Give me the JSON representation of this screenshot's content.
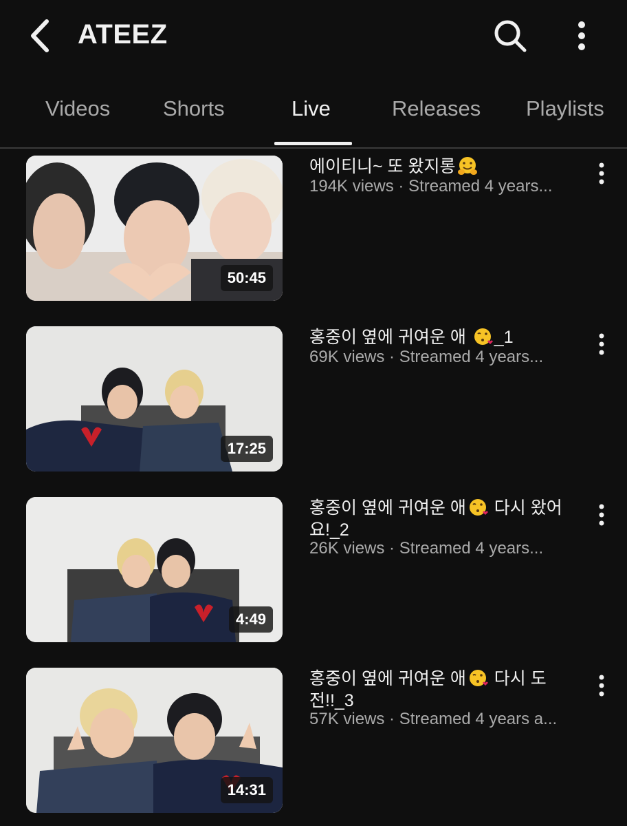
{
  "header": {
    "title": "ATEEZ",
    "back_icon": "chevron-left-icon",
    "search_icon": "search-icon",
    "more_icon": "more-vertical-icon"
  },
  "tabs": [
    {
      "label": "Videos"
    },
    {
      "label": "Shorts"
    },
    {
      "label": "Live",
      "active": true
    },
    {
      "label": "Releases"
    },
    {
      "label": "Playlists"
    }
  ],
  "videos": [
    {
      "title_pre": "에이티니~ 또 왔지롱",
      "title_emoji": "hugging-face-emoji",
      "title_post": "",
      "meta": "194K views · Streamed 4 years...",
      "duration": "50:45"
    },
    {
      "title_pre": "홍중이 옆에 귀여운 애 ",
      "title_emoji": "face-blowing-kiss-emoji",
      "title_post": "_1",
      "meta": "69K views · Streamed 4 years...",
      "duration": "17:25"
    },
    {
      "title_pre": "홍중이 옆에 귀여운 애",
      "title_emoji": "face-blowing-kiss-emoji",
      "title_post": " 다시 왔어요!_2",
      "meta": "26K views · Streamed 4 years...",
      "duration": "4:49"
    },
    {
      "title_pre": "홍중이 옆에 귀여운 애",
      "title_emoji": "face-blowing-kiss-emoji",
      "title_post": " 다시 도전!!_3",
      "meta": "57K views · Streamed 4 years a...",
      "duration": "14:31"
    }
  ],
  "colors": {
    "background": "#0f0f0f",
    "text_primary": "#f1f1f1",
    "text_secondary": "#aaaaaa",
    "divider": "#3a3a3a"
  }
}
